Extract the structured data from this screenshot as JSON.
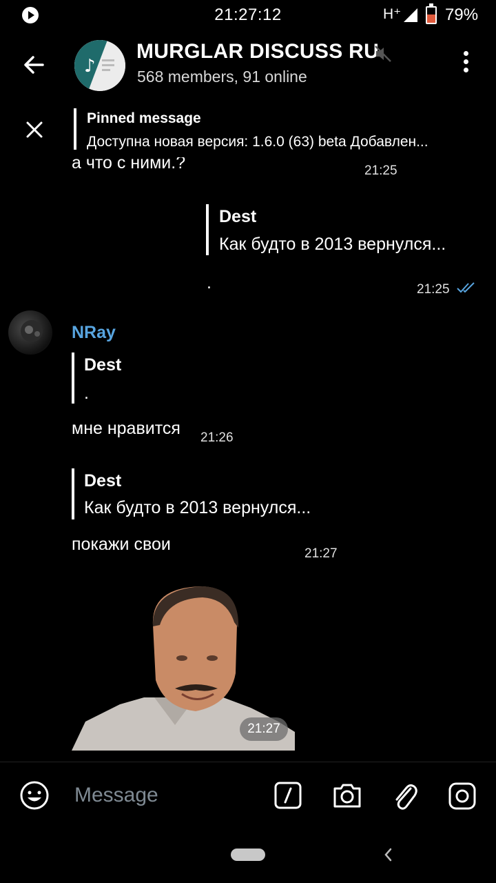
{
  "status_bar": {
    "time": "21:27:12",
    "network": "H⁺",
    "battery_percent": "79%"
  },
  "header": {
    "title": "MURGLAR DISCUSS RU",
    "subtitle": "568 members, 91 online"
  },
  "pinned": {
    "title": "Pinned message",
    "text": "Доступна новая версия: 1.6.0 (63) beta  Добавлен..."
  },
  "messages": [
    {
      "text": "а что с ними.?",
      "time": "21:25"
    },
    {
      "reply_name": "Dest",
      "reply_text": "Как будто в 2013 вернулся...",
      "text": ".",
      "time": "21:25",
      "status": "read"
    },
    {
      "author": "NRay",
      "reply_name": "Dest",
      "reply_text": ".",
      "text": "мне нравится",
      "time": "21:26"
    },
    {
      "reply_name": "Dest",
      "reply_text": "Как будто в 2013 вернулся...",
      "text": "покажи свои",
      "time": "21:27"
    },
    {
      "type": "sticker",
      "time": "21:27"
    }
  ],
  "input": {
    "placeholder": "Message"
  },
  "colors": {
    "author_name": "#58a5e0",
    "read_checks": "#58a5e0",
    "background": "#000000"
  }
}
